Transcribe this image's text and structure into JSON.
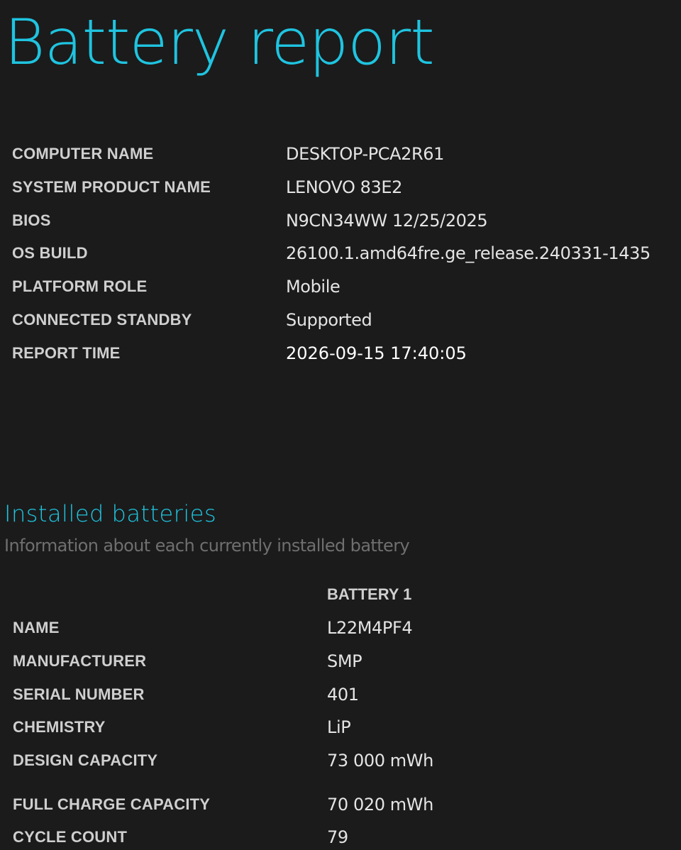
{
  "title": "Battery report",
  "system": [
    {
      "label": "COMPUTER NAME",
      "value": "DESKTOP-PCA2R61"
    },
    {
      "label": "SYSTEM PRODUCT NAME",
      "value": "LENOVO 83E2"
    },
    {
      "label": "BIOS",
      "value": "N9CN34WW 12/25/2025"
    },
    {
      "label": "OS BUILD",
      "value": "26100.1.amd64fre.ge_release.240331-1435"
    },
    {
      "label": "PLATFORM ROLE",
      "value": "Mobile"
    },
    {
      "label": "CONNECTED STANDBY",
      "value": "Supported"
    },
    {
      "label": "REPORT TIME",
      "value": "2026-09-15  17:40:05"
    }
  ],
  "installed_batteries": {
    "heading": "Installed batteries",
    "subheading": "Information about each currently installed battery",
    "column_header": "BATTERY 1",
    "rows": [
      {
        "label": "NAME",
        "value": "L22M4PF4"
      },
      {
        "label": "MANUFACTURER",
        "value": "SMP"
      },
      {
        "label": "SERIAL NUMBER",
        "value": "401"
      },
      {
        "label": "CHEMISTRY",
        "value": "LiP"
      },
      {
        "label": "DESIGN CAPACITY",
        "value": "73 000 mWh"
      },
      {
        "label": "FULL CHARGE CAPACITY",
        "value": "70 020 mWh"
      },
      {
        "label": "CYCLE COUNT",
        "value": "79"
      }
    ]
  },
  "colors": {
    "background": "#1b1b1b",
    "accent": "#1fc4e0",
    "label": "#cfcfcf",
    "subtext": "#6f6f6f"
  }
}
